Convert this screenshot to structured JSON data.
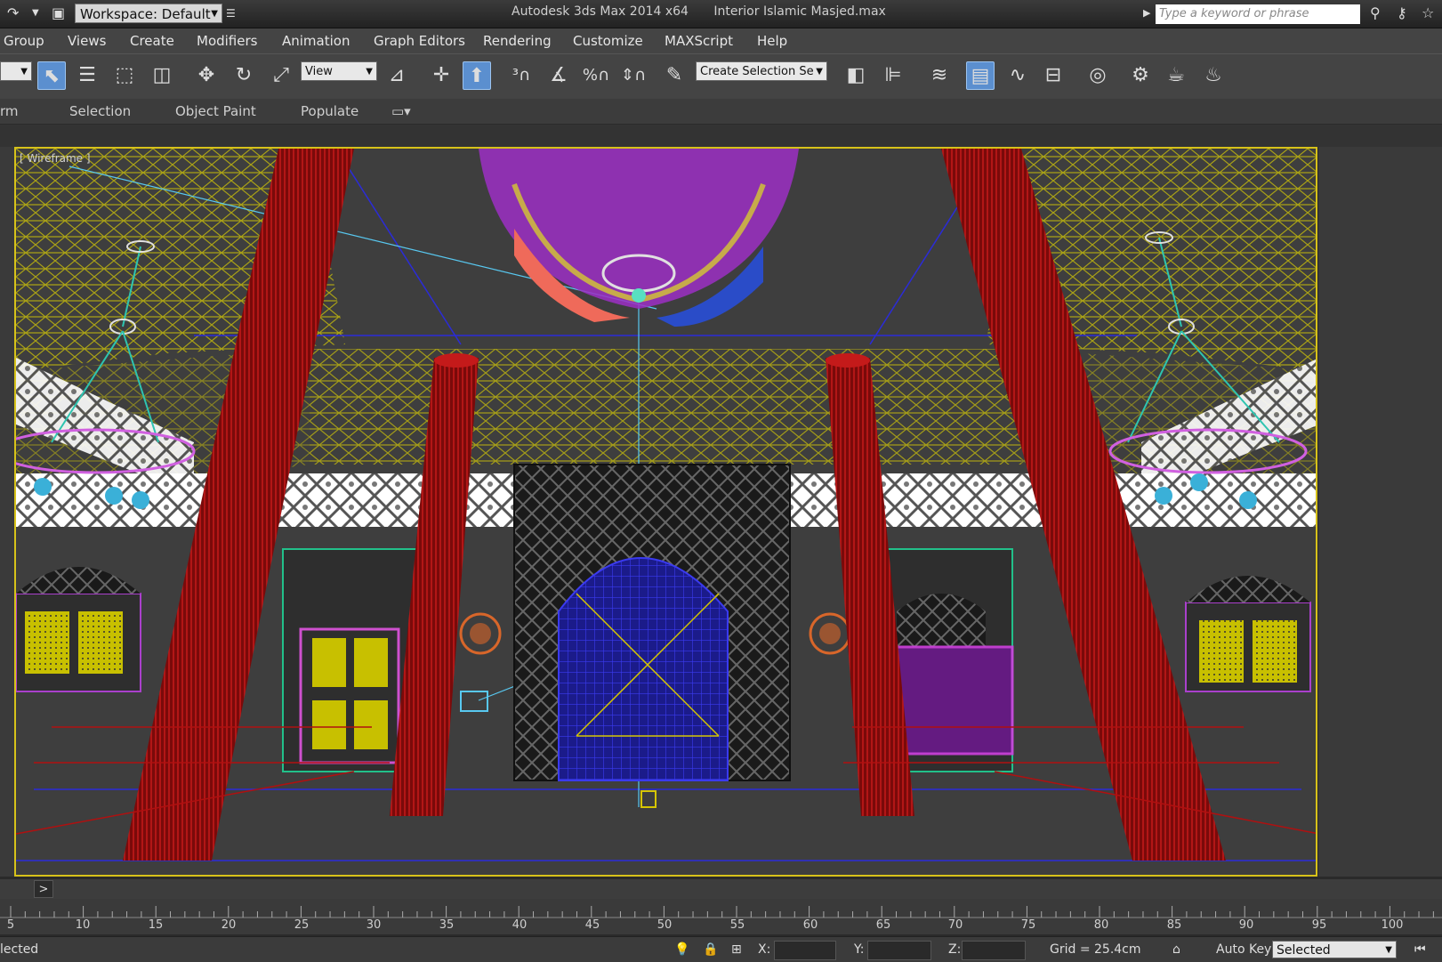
{
  "titlebar": {
    "workspace": "Workspace: Default",
    "app": "Autodesk 3ds Max  2014 x64",
    "file": "Interior Islamic Masjed.max",
    "search_placeholder": "Type a keyword or phrase"
  },
  "menu": {
    "items": [
      "Group",
      "Views",
      "Create",
      "Modifiers",
      "Animation",
      "Graph Editors",
      "Rendering",
      "Customize",
      "MAXScript",
      "Help"
    ]
  },
  "toolbar": {
    "ref_coord": "View",
    "selection_set": "Create Selection Se"
  },
  "ribbon": {
    "items": [
      "rm",
      "Selection",
      "Object Paint",
      "Populate"
    ]
  },
  "viewport": {
    "label": "[ Wireframe ]"
  },
  "timeslider": {
    "next_label": ">"
  },
  "ruler": {
    "ticks": [
      "5",
      "10",
      "15",
      "20",
      "25",
      "30",
      "35",
      "40",
      "45",
      "50",
      "55",
      "60",
      "65",
      "70",
      "75",
      "80",
      "85",
      "90",
      "95",
      "100"
    ]
  },
  "status": {
    "selected_text": "lected",
    "x_label": "X:",
    "y_label": "Y:",
    "z_label": "Z:",
    "grid": "Grid = 25.4cm",
    "autokey": "Auto Key",
    "key_filter": "Selected"
  },
  "colors": {
    "viewport_border": "#d7c21a",
    "active_tool": "#5b8fcf",
    "column": "#9a0e0e",
    "ceiling": "#b5ac12",
    "chandelier": "#b23fd1"
  }
}
